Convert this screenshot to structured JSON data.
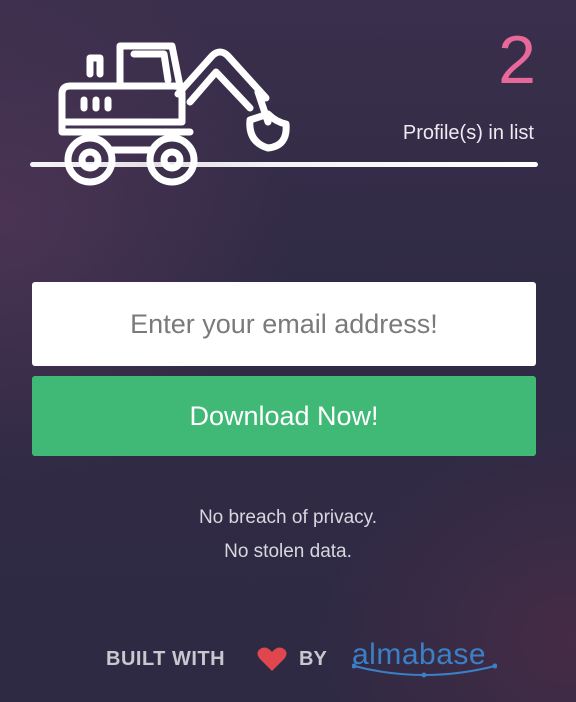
{
  "header": {
    "icon": "excavator-icon",
    "profile_count": "2",
    "profile_count_label": "Profile(s) in list"
  },
  "form": {
    "email_placeholder": "Enter your email address!",
    "email_value": "",
    "download_label": "Download Now!"
  },
  "notes": {
    "line1": "No breach of privacy.",
    "line2": "No stolen data."
  },
  "footer": {
    "built_with": "BUILT WITH",
    "heart_icon": "heart-icon",
    "by": "BY",
    "brand": "almabase"
  },
  "colors": {
    "accent_pink": "#e9689a",
    "button_green": "#3fb975",
    "heart_red": "#e0464e",
    "brand_blue": "#3b80c7"
  }
}
